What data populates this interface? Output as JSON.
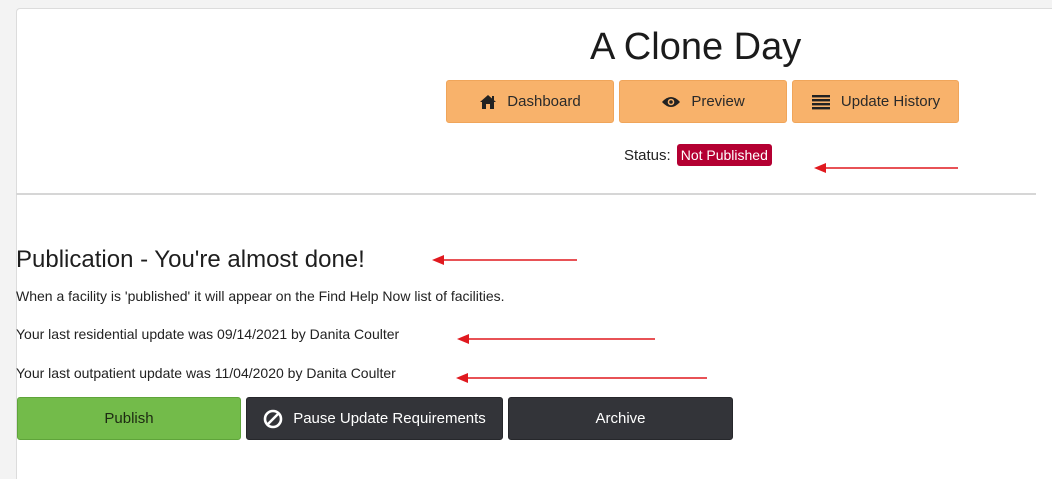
{
  "header": {
    "title": "A Clone Day",
    "nav": [
      {
        "label": "Dashboard",
        "icon": "home-icon"
      },
      {
        "label": "Preview",
        "icon": "eye-icon"
      },
      {
        "label": "Update History",
        "icon": "list-icon"
      }
    ],
    "status_label": "Status:",
    "status_value": "Not Published"
  },
  "publication": {
    "heading": "Publication - You're almost done!",
    "description": "When a facility is 'published' it will appear on the Find Help Now list of facilities.",
    "residential_update": "Your last residential update was 09/14/2021 by Danita Coulter",
    "outpatient_update": "Your last outpatient update was 11/04/2020 by Danita Coulter"
  },
  "actions": {
    "publish": "Publish",
    "pause": "Pause Update Requirements",
    "archive": "Archive"
  },
  "colors": {
    "nav_button": "#f8b26b",
    "status_badge": "#b40032",
    "publish_button": "#73bb4a",
    "dark_button": "#333439",
    "annotation_arrow": "#e0191f"
  }
}
